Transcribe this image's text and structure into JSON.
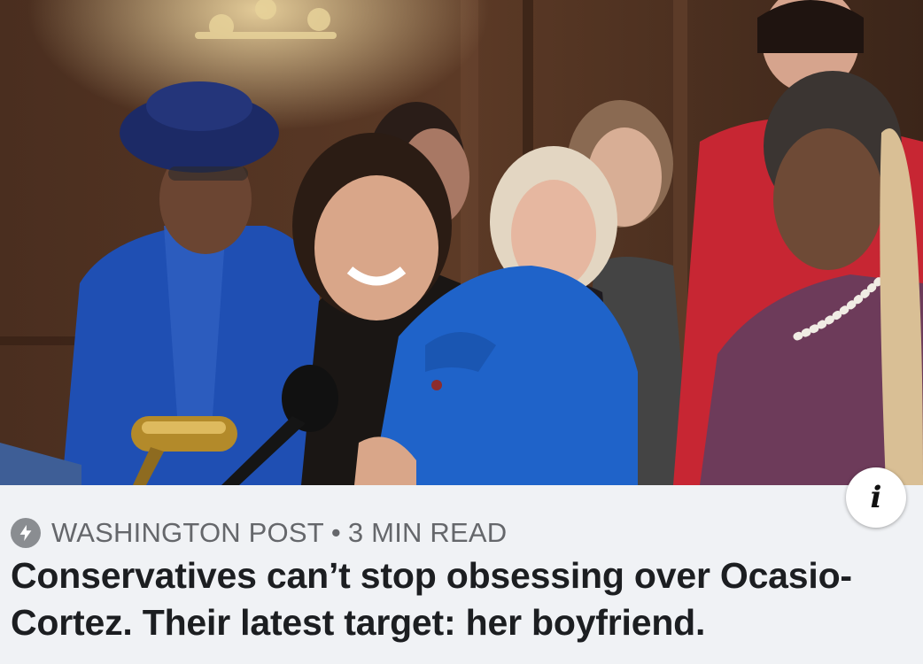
{
  "card": {
    "image": {
      "alt_subject": "press-conference-photo"
    },
    "info_button": {
      "glyph": "i",
      "icon": "info-icon"
    },
    "meta": {
      "icon": "lightning-bolt-icon",
      "source": "WASHINGTON POST",
      "separator": "•",
      "read_time": "3 MIN READ"
    },
    "headline": "Conservatives can’t stop obsessing over Ocasio-Cortez. Their latest target: her boyfriend."
  },
  "colors": {
    "background": "#f0f2f5",
    "meta_text": "#65676b",
    "headline_text": "#1c1e21",
    "icon_fill": "#8a8d91"
  }
}
